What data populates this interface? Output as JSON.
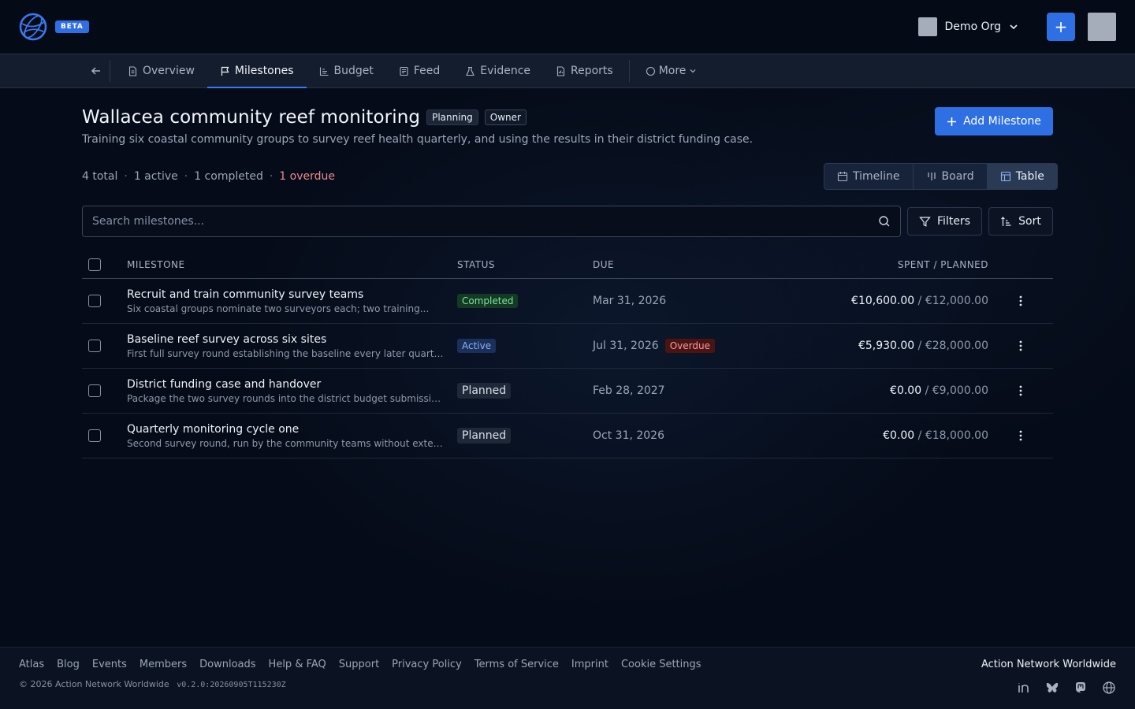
{
  "header": {
    "beta_label": "BETA",
    "org_name": "Demo Org",
    "plus_label": "+"
  },
  "nav": {
    "tabs": [
      {
        "label": "Overview",
        "icon": "document-icon"
      },
      {
        "label": "Milestones",
        "icon": "flag-icon"
      },
      {
        "label": "Budget",
        "icon": "chart-icon"
      },
      {
        "label": "Feed",
        "icon": "feed-icon"
      },
      {
        "label": "Evidence",
        "icon": "flask-icon"
      },
      {
        "label": "Reports",
        "icon": "report-icon"
      }
    ],
    "more_label": "More",
    "active_tab": "Milestones"
  },
  "project": {
    "title": "Wallacea community reef monitoring",
    "status_pill": "Planning",
    "role_pill": "Owner",
    "description": "Training six coastal community groups to survey reef health quarterly, and using the results in their district funding case.",
    "add_button": "Add Milestone"
  },
  "stats": {
    "total": "4 total",
    "active": "1 active",
    "completed": "1 completed",
    "overdue": "1 overdue"
  },
  "views": {
    "timeline": "Timeline",
    "board": "Board",
    "table": "Table",
    "selected": "Table"
  },
  "search": {
    "placeholder": "Search milestones...",
    "filters_label": "Filters",
    "sort_label": "Sort"
  },
  "table": {
    "headers": {
      "milestone": "MILESTONE",
      "status": "STATUS",
      "due": "DUE",
      "spent": "SPENT / PLANNED"
    },
    "rows": [
      {
        "title": "Recruit and train community survey teams",
        "desc": "Six coastal groups nominate two surveyors each; two training...",
        "status": "Completed",
        "status_kind": "completed",
        "due": "Mar 31, 2026",
        "overdue": "",
        "spent": "€10,600.00",
        "planned": " / €12,000.00"
      },
      {
        "title": "Baseline reef survey across six sites",
        "desc": "First full survey round establishing the baseline every later quarter is...",
        "status": "Active",
        "status_kind": "active",
        "due": "Jul 31, 2026",
        "overdue": "Overdue",
        "spent": "€5,930.00",
        "planned": " / €28,000.00"
      },
      {
        "title": "District funding case and handover",
        "desc": "Package the two survey rounds into the district budget submission an...",
        "status": "Planned",
        "status_kind": "planned",
        "due": "Feb 28, 2027",
        "overdue": "",
        "spent": "€0.00",
        "planned": " / €9,000.00"
      },
      {
        "title": "Quarterly monitoring cycle one",
        "desc": "Second survey round, run by the community teams without external...",
        "status": "Planned",
        "status_kind": "planned",
        "due": "Oct 31, 2026",
        "overdue": "",
        "spent": "€0.00",
        "planned": " / €18,000.00"
      }
    ]
  },
  "footer": {
    "links": [
      "Atlas",
      "Blog",
      "Events",
      "Members",
      "Downloads",
      "Help & FAQ",
      "Support",
      "Privacy Policy",
      "Terms of Service",
      "Imprint",
      "Cookie Settings"
    ],
    "copyright": "© 2026 Action Network Worldwide",
    "version": "v0.2.0:20260905T115230Z",
    "org": "Action Network Worldwide",
    "socials": [
      "linkedin-icon",
      "bluesky-icon",
      "mastodon-icon",
      "globe-icon"
    ]
  },
  "colors": {
    "accent": "#2f6fe4",
    "background": "#050b18",
    "overdue": "#f08a8a"
  }
}
